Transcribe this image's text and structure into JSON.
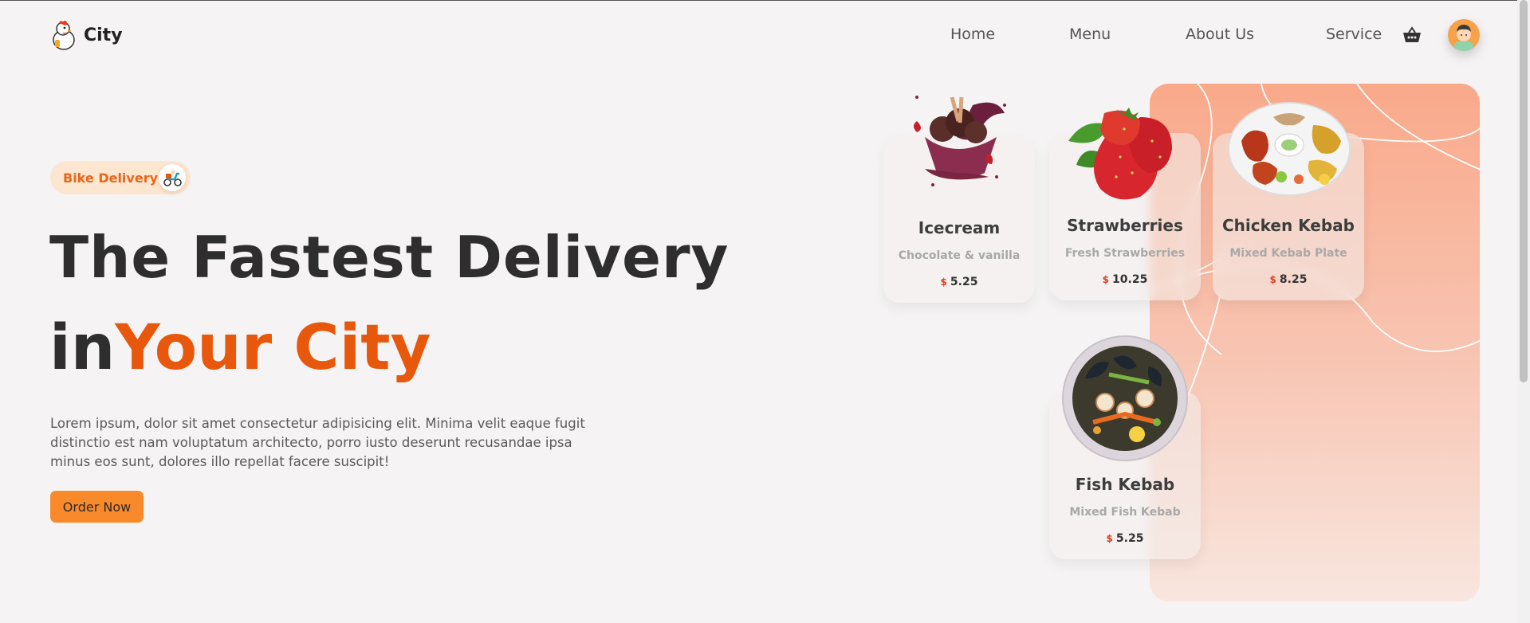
{
  "header": {
    "logo_text": "City",
    "nav": [
      {
        "label": "Home"
      },
      {
        "label": "Menu"
      },
      {
        "label": "About Us"
      },
      {
        "label": "Service"
      }
    ]
  },
  "hero": {
    "badge": "Bike Delivery",
    "title_line1": "The Fastest Delivery",
    "title_in": "in",
    "title_highlight": "Your City",
    "description": "Lorem ipsum, dolor sit amet consectetur adipisicing elit. Minima velit eaque fugit distinctio est nam voluptatum architecto, porro iusto deserunt recusandae ipsa minus eos sunt, dolores illo repellat facere suscipit!",
    "cta": "Order Now"
  },
  "cards": [
    {
      "title": "Icecream",
      "subtitle": "Chocolate & vanilla",
      "currency": "$",
      "price": "5.25"
    },
    {
      "title": "Strawberries",
      "subtitle": "Fresh Strawberries",
      "currency": "$",
      "price": "10.25"
    },
    {
      "title": "Chicken Kebab",
      "subtitle": "Mixed Kebab Plate",
      "currency": "$",
      "price": "8.25"
    },
    {
      "title": "Fish Kebab",
      "subtitle": "Mixed Fish Kebab",
      "currency": "$",
      "price": "5.25"
    }
  ],
  "colors": {
    "accent": "#e8580c",
    "button": "#f98a2c",
    "panel": "#f9a98a",
    "background": "#f5f3f3"
  },
  "icons": [
    "chicken-logo-icon",
    "basket-icon",
    "avatar",
    "scooter-icon"
  ]
}
